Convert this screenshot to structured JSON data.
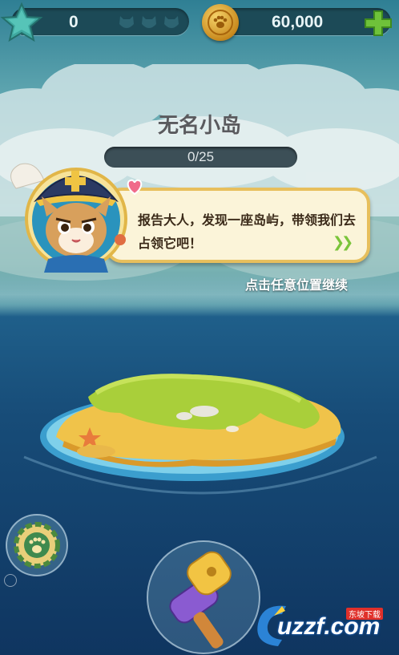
{
  "hud": {
    "stars": "0",
    "coins": "60,000",
    "heart_slots": 3
  },
  "island": {
    "name": "无名小岛",
    "progress_text": "0/25",
    "progress_fraction": 0
  },
  "dialog": {
    "message": "报告大人，发现一座岛屿，带领我们去占领它吧！",
    "continue_hint": "点击任意位置继续"
  },
  "watermark": {
    "brand": "uzzf.com",
    "sub": "东坡下载"
  },
  "icons": [
    "star-icon",
    "heart-slot-icon",
    "coin-paw-icon",
    "plus-icon",
    "heart-icon",
    "next-arrows-icon",
    "paw-button-icon",
    "hammer-icon"
  ],
  "colors": {
    "hud_pill": "#1c4a57",
    "coin_gold": "#e2a531",
    "plus_green": "#6fc23a",
    "dialog_bg": "#fbf4d9",
    "dialog_border": "#e7bf5c",
    "progress_track": "#3c4f57"
  }
}
